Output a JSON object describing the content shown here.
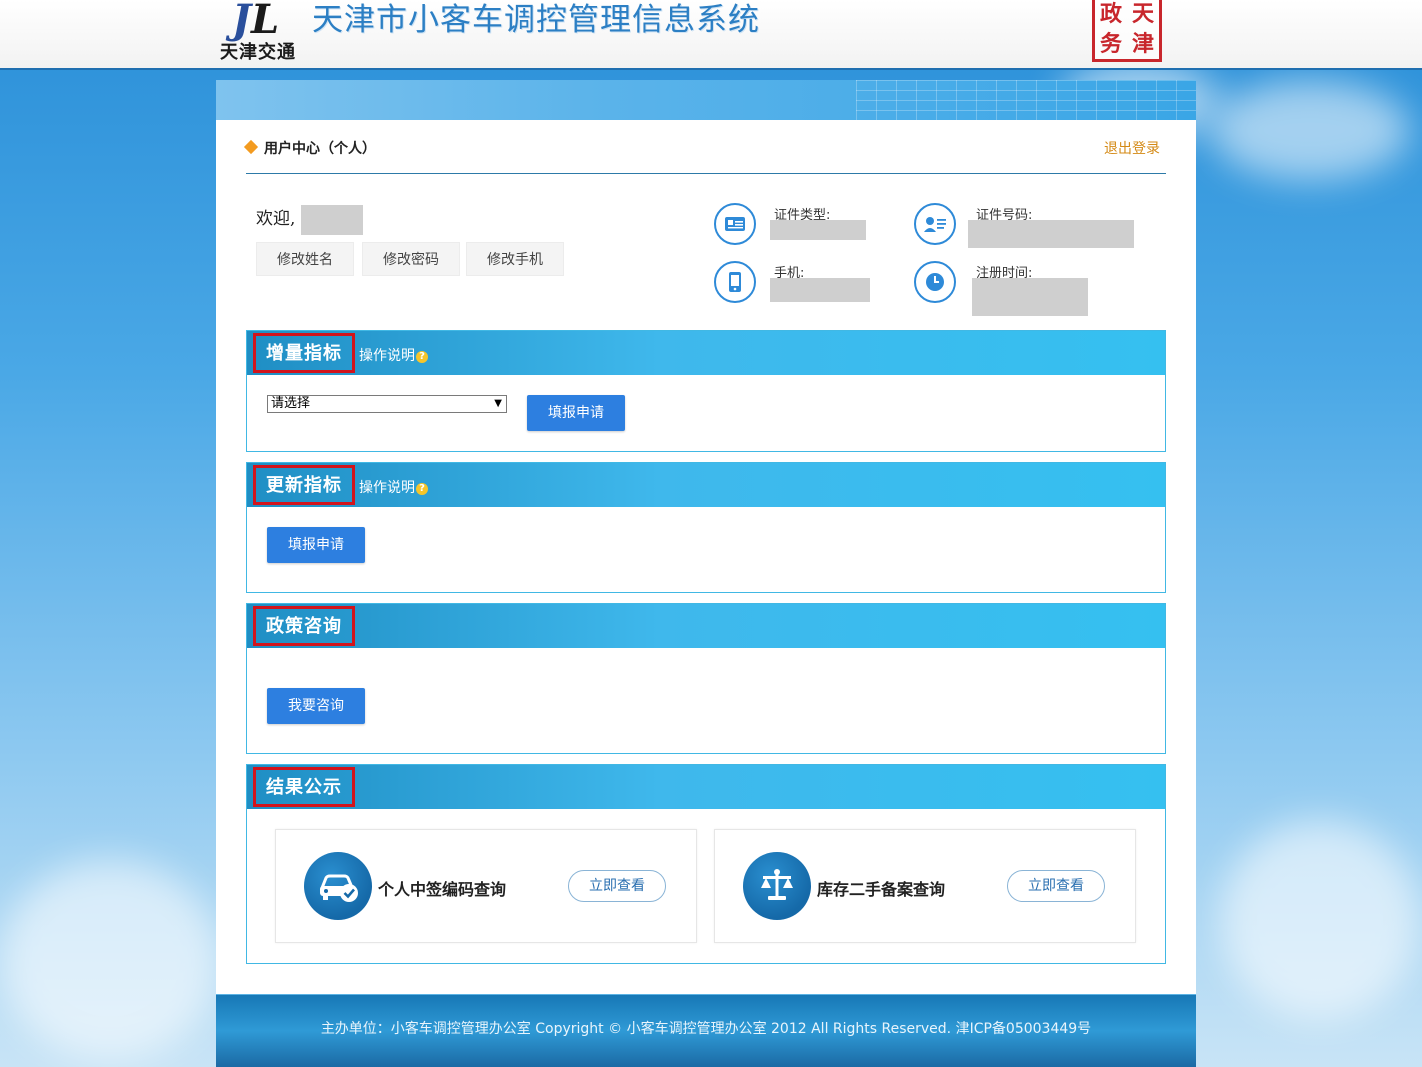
{
  "header": {
    "logo_text": "天津交通",
    "system_title": "天津市小客车调控管理信息系统",
    "seal_chars": [
      "天",
      "津",
      "政",
      "务"
    ]
  },
  "user_center": {
    "title": "用户中心（个人）",
    "logout": "退出登录",
    "welcome": "欢迎,",
    "buttons": [
      "修改姓名",
      "修改密码",
      "修改手机"
    ],
    "info": {
      "cert_type_label": "证件类型:",
      "cert_no_label": "证件号码:",
      "phone_label": "手机:",
      "reg_time_label": "注册时间:"
    }
  },
  "sections": {
    "increment": {
      "title": "增量指标",
      "note": "操作说明",
      "select_value": "请选择",
      "button": "填报申请"
    },
    "renewal": {
      "title": "更新指标",
      "note": "操作说明",
      "button": "填报申请"
    },
    "policy": {
      "title": "政策咨询",
      "button": "我要咨询"
    },
    "results": {
      "title": "结果公示",
      "cards": [
        {
          "title": "个人中签编码查询",
          "button": "立即查看",
          "icon": "car-check-icon"
        },
        {
          "title": "库存二手备案查询",
          "button": "立即查看",
          "icon": "scale-icon"
        }
      ]
    }
  },
  "footer": {
    "text": "主办单位：小客车调控管理办公室  Copyright  ©  小客车调控管理办公室    2012  All Rights Reserved.  津ICP备05003449号"
  },
  "colors": {
    "accent_blue": "#2d7fe0",
    "highlight_red": "#d2141c",
    "logout_orange": "#d48a16"
  }
}
